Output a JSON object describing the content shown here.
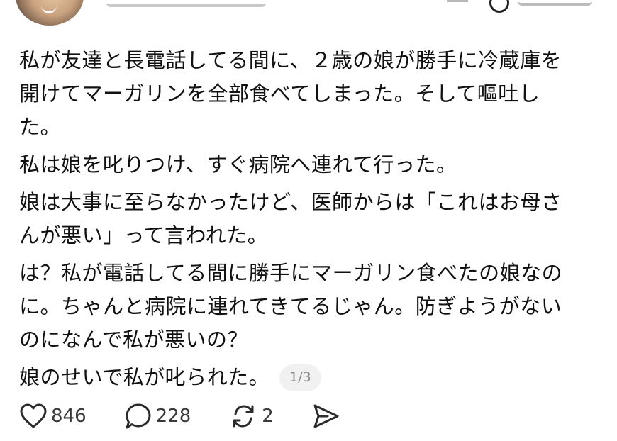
{
  "post": {
    "paragraphs": [
      "私が友達と長電話してる間に、２歳の娘が勝手に冷蔵庫を\n開けてマーガリンを全部食べてしまった。そして嘔吐し\nた。",
      "私は娘を叱りつけ、すぐ病院へ連れて行った。",
      "娘は大事に至らなかったけど、医師からは「これはお母さ\nんが悪い」って言われた。",
      "は？私が電話してる間に勝手にマーガリン食べたの娘なの\nに。ちゃんと病院に連れてきてるじゃん。防ぎようがない\nのになんで私が悪いの？"
    ],
    "last_line": "娘のせいで私が叱られた。",
    "page_indicator": "1/3"
  },
  "actions": {
    "like": {
      "icon": "heart-icon",
      "count": "846"
    },
    "comment": {
      "icon": "speech-bubble-icon",
      "count": "228"
    },
    "repost": {
      "icon": "repost-icon",
      "count": "2"
    },
    "share": {
      "icon": "send-icon"
    }
  }
}
